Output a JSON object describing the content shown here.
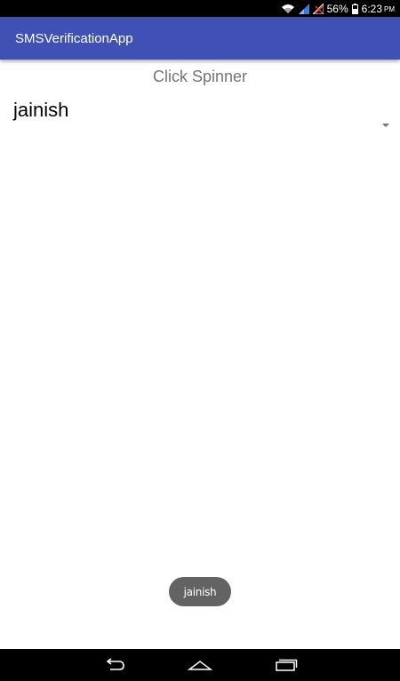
{
  "status_bar": {
    "battery_percent": "56%",
    "time": "6:23",
    "ampm": "PM",
    "icons": [
      "wifi-icon",
      "signal-icon",
      "no-signal-icon",
      "battery-icon"
    ]
  },
  "app_bar": {
    "title": "SMSVerificationApp",
    "color": "#3f51b5"
  },
  "main": {
    "heading": "Click Spinner",
    "spinner": {
      "selected_value": "jainish"
    }
  },
  "toast": {
    "message": "jainish"
  },
  "nav_bar": {
    "buttons": [
      "back-icon",
      "home-icon",
      "recents-icon"
    ]
  }
}
